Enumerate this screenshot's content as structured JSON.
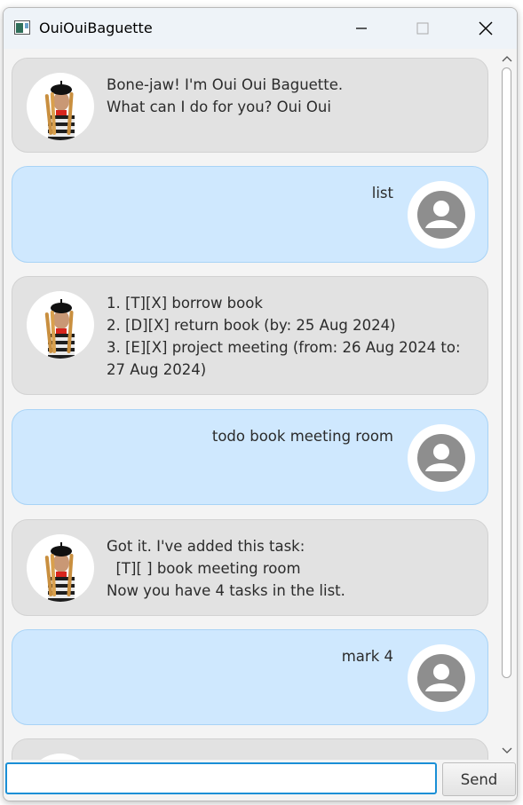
{
  "window": {
    "title": "OuiOuiBaguette"
  },
  "messages": [
    {
      "from": "bot",
      "text": "Bone-jaw! I'm Oui Oui Baguette.\nWhat can I do for you? Oui Oui"
    },
    {
      "from": "user",
      "text": "list"
    },
    {
      "from": "bot",
      "text": "1. [T][X] borrow book\n2. [D][X] return book (by: 25 Aug 2024)\n3. [E][X] project meeting (from: 26 Aug 2024 to: 27 Aug 2024)"
    },
    {
      "from": "user",
      "text": "todo book meeting room"
    },
    {
      "from": "bot",
      "text": "Got it. I've added this task:\n  [T][ ] book meeting room\nNow you have 4 tasks in the list."
    },
    {
      "from": "user",
      "text": "mark 4"
    }
  ],
  "input": {
    "value": "",
    "placeholder": ""
  },
  "send_label": "Send",
  "colors": {
    "bot_bubble": "#e2e2e2",
    "user_bubble": "#cfe8fe",
    "input_focus": "#1a8fd6"
  }
}
